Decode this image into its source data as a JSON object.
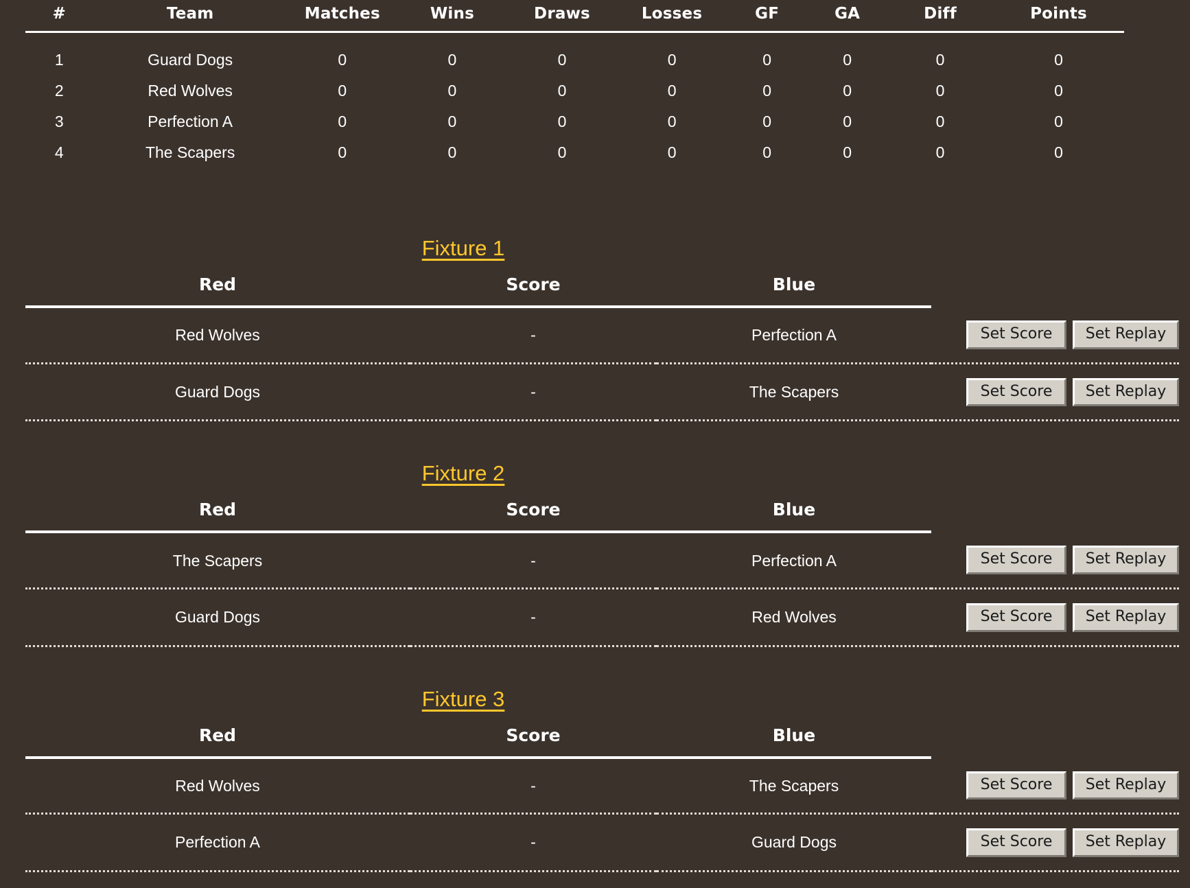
{
  "theme": {
    "background": "#3b322c",
    "text": "#ffffff",
    "link": "#ffc72c",
    "rule": "#ffffff",
    "dotted_rule": "#e4ded6",
    "button_face": "#d4d0c8",
    "button_text": "#1a1a1a"
  },
  "standings": {
    "columns": [
      "#",
      "Team",
      "Matches",
      "Wins",
      "Draws",
      "Losses",
      "GF",
      "GA",
      "Diff",
      "Points"
    ],
    "rows": [
      {
        "rank": "1",
        "team": "Guard Dogs",
        "matches": "0",
        "wins": "0",
        "draws": "0",
        "losses": "0",
        "gf": "0",
        "ga": "0",
        "diff": "0",
        "points": "0"
      },
      {
        "rank": "2",
        "team": "Red Wolves",
        "matches": "0",
        "wins": "0",
        "draws": "0",
        "losses": "0",
        "gf": "0",
        "ga": "0",
        "diff": "0",
        "points": "0"
      },
      {
        "rank": "3",
        "team": "Perfection A",
        "matches": "0",
        "wins": "0",
        "draws": "0",
        "losses": "0",
        "gf": "0",
        "ga": "0",
        "diff": "0",
        "points": "0"
      },
      {
        "rank": "4",
        "team": "The Scapers",
        "matches": "0",
        "wins": "0",
        "draws": "0",
        "losses": "0",
        "gf": "0",
        "ga": "0",
        "diff": "0",
        "points": "0"
      }
    ]
  },
  "fixture_table_columns": {
    "red": "Red",
    "score": "Score",
    "blue": "Blue"
  },
  "buttons": {
    "set_score": "Set Score",
    "set_replay": "Set Replay"
  },
  "fixtures": [
    {
      "title": "Fixture 1",
      "matches": [
        {
          "red": "Red Wolves",
          "score": "-",
          "blue": "Perfection A"
        },
        {
          "red": "Guard Dogs",
          "score": "-",
          "blue": "The Scapers"
        }
      ]
    },
    {
      "title": "Fixture 2",
      "matches": [
        {
          "red": "The Scapers",
          "score": "-",
          "blue": "Perfection A"
        },
        {
          "red": "Guard Dogs",
          "score": "-",
          "blue": "Red Wolves"
        }
      ]
    },
    {
      "title": "Fixture 3",
      "matches": [
        {
          "red": "Red Wolves",
          "score": "-",
          "blue": "The Scapers"
        },
        {
          "red": "Perfection A",
          "score": "-",
          "blue": "Guard Dogs"
        }
      ]
    }
  ]
}
